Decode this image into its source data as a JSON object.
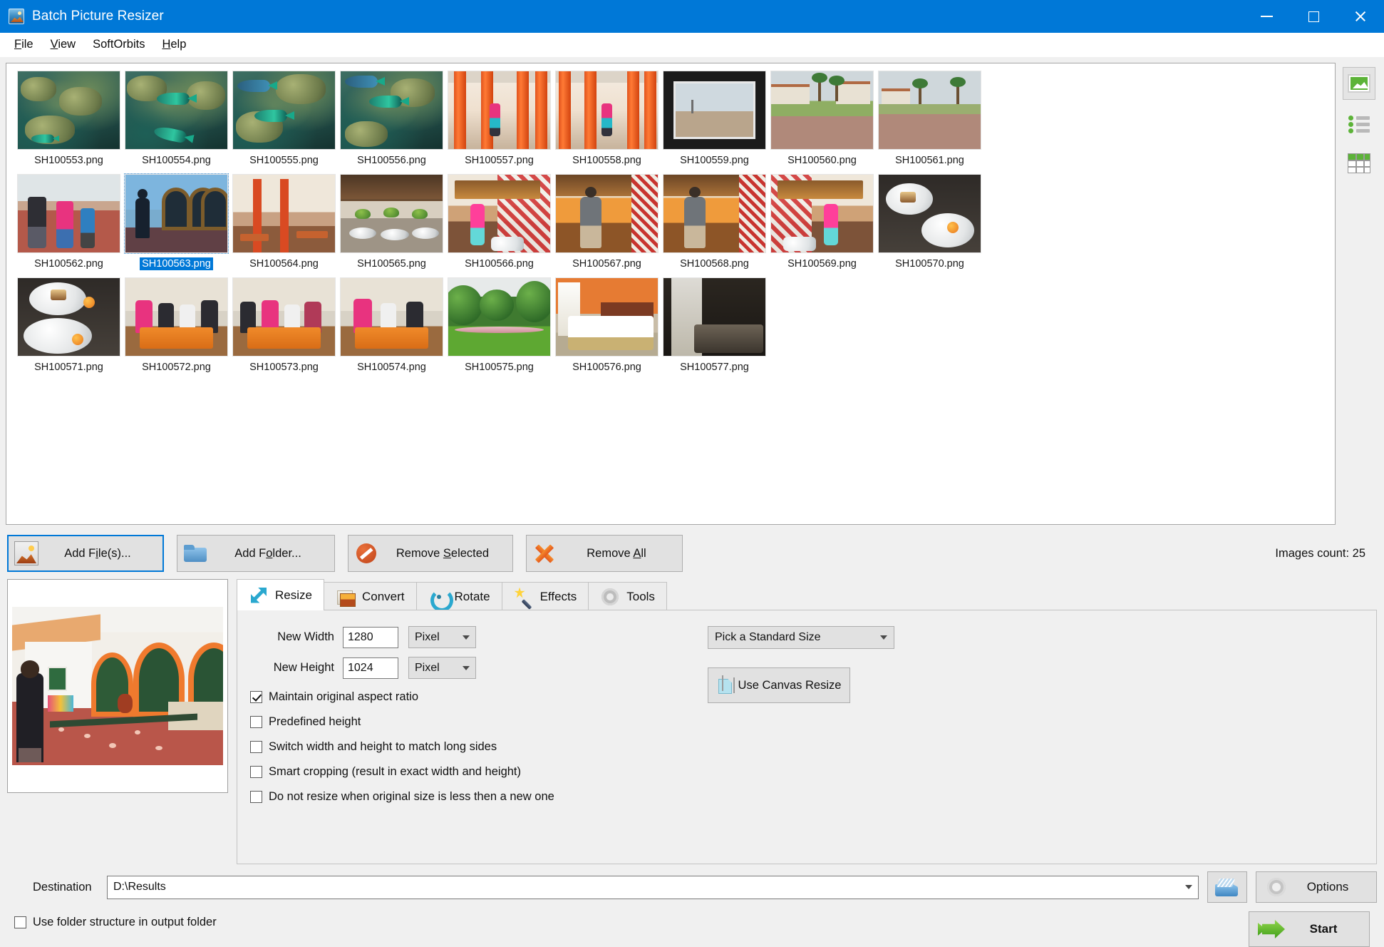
{
  "window": {
    "title": "Batch Picture Resizer",
    "icon": "app-icon",
    "minimize": "minimize",
    "maximize": "maximize",
    "close": "close"
  },
  "menu": {
    "items": [
      {
        "label": "File",
        "accel": "F"
      },
      {
        "label": "View",
        "accel": "V"
      },
      {
        "label": "SoftOrbits",
        "accel": ""
      },
      {
        "label": "Help",
        "accel": "H"
      }
    ]
  },
  "view_modes": [
    {
      "name": "thumbnail-view",
      "active": true
    },
    {
      "name": "list-view",
      "active": false
    },
    {
      "name": "details-view",
      "active": false
    }
  ],
  "file_list": {
    "selected": "SH100563.png",
    "rows": [
      [
        {
          "name": "SH100553.png",
          "scene": "reef"
        },
        {
          "name": "SH100554.png",
          "scene": "reef"
        },
        {
          "name": "SH100555.png",
          "scene": "reef"
        },
        {
          "name": "SH100556.png",
          "scene": "reef"
        },
        {
          "name": "SH100557.png",
          "scene": "corridor"
        },
        {
          "name": "SH100558.png",
          "scene": "corridor"
        },
        {
          "name": "SH100559.png",
          "scene": "framed"
        },
        {
          "name": "SH100560.png",
          "scene": "promenade"
        },
        {
          "name": "SH100561.png",
          "scene": "promenade"
        }
      ],
      [
        {
          "name": "SH100562.png",
          "scene": "plaza"
        },
        {
          "name": "SH100563.png",
          "scene": "courtyard"
        },
        {
          "name": "SH100564.png",
          "scene": "resto"
        },
        {
          "name": "SH100565.png",
          "scene": "buffet"
        },
        {
          "name": "SH100566.png",
          "scene": "redwall"
        },
        {
          "name": "SH100567.png",
          "scene": "warmbuf"
        },
        {
          "name": "SH100568.png",
          "scene": "warmbuf"
        },
        {
          "name": "SH100569.png",
          "scene": "redwall"
        },
        {
          "name": "SH100570.png",
          "scene": "dessert"
        }
      ],
      [
        {
          "name": "SH100571.png",
          "scene": "dessert"
        },
        {
          "name": "SH100572.png",
          "scene": "tablefolk"
        },
        {
          "name": "SH100573.png",
          "scene": "tablefolk"
        },
        {
          "name": "SH100574.png",
          "scene": "tablefolk"
        },
        {
          "name": "SH100575.png",
          "scene": "garden"
        },
        {
          "name": "SH100576.png",
          "scene": "bedroom"
        },
        {
          "name": "SH100577.png",
          "scene": "darkroom"
        }
      ]
    ]
  },
  "toolbar": {
    "add_files": "Add File(s)...",
    "add_folder": "Add Folder...",
    "remove_selected": "Remove Selected",
    "remove_all": "Remove All",
    "images_count": "Images count: 25"
  },
  "tabs": [
    {
      "label": "Resize",
      "icon": "resize-icon",
      "active": true
    },
    {
      "label": "Convert",
      "icon": "convert-icon",
      "active": false
    },
    {
      "label": "Rotate",
      "icon": "rotate-icon",
      "active": false
    },
    {
      "label": "Effects",
      "icon": "effects-icon",
      "active": false
    },
    {
      "label": "Tools",
      "icon": "tools-icon",
      "active": false
    }
  ],
  "resize": {
    "new_width_label": "New Width",
    "new_width_value": "1280",
    "new_width_unit": "Pixel",
    "new_height_label": "New Height",
    "new_height_value": "1024",
    "new_height_unit": "Pixel",
    "standard_size": "Pick a Standard Size",
    "canvas_resize": "Use Canvas Resize",
    "checkboxes": [
      {
        "label": "Maintain original aspect ratio",
        "checked": true
      },
      {
        "label": "Predefined height",
        "checked": false
      },
      {
        "label": "Switch width and height to match long sides",
        "checked": false
      },
      {
        "label": "Smart cropping (result in exact width and height)",
        "checked": false
      },
      {
        "label": "Do not resize when original size is less then a new one",
        "checked": false
      }
    ]
  },
  "destination": {
    "label": "Destination",
    "value": "D:\\Results",
    "browse": "browse-folder",
    "use_folder_structure": "Use folder structure in output folder",
    "use_folder_structure_checked": false
  },
  "actions": {
    "options": "Options",
    "start": "Start"
  },
  "colors": {
    "titlebar": "#0078d7",
    "accent": "#0078d7",
    "selection": "#0078d7",
    "panel": "#f0f0f0",
    "button": "#e1e1e1",
    "start_green": "#5cb338"
  }
}
